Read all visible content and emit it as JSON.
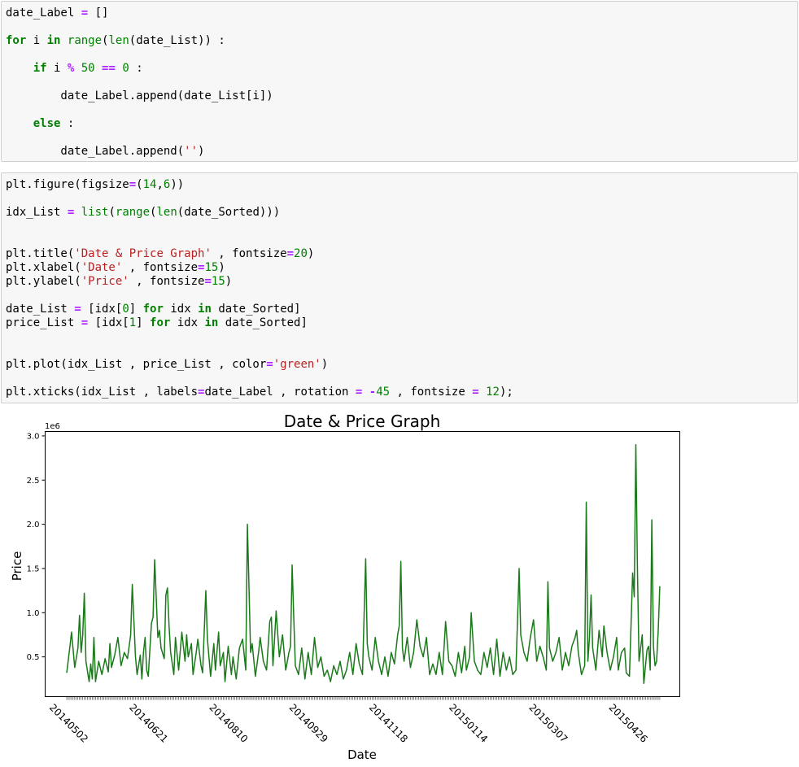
{
  "cell1": {
    "lines": [
      [
        [
          "t",
          "date_Label "
        ],
        [
          "op",
          "="
        ],
        [
          "t",
          " []"
        ]
      ],
      [
        [
          "kw",
          "for"
        ],
        [
          "t",
          " i "
        ],
        [
          "kw",
          "in"
        ],
        [
          "t",
          " "
        ],
        [
          "bi",
          "range"
        ],
        [
          "t",
          "("
        ],
        [
          "bi",
          "len"
        ],
        [
          "t",
          "(date_List)) :"
        ]
      ],
      [
        [
          "t",
          "    "
        ],
        [
          "kw",
          "if"
        ],
        [
          "t",
          " i "
        ],
        [
          "op",
          "%"
        ],
        [
          "t",
          " "
        ],
        [
          "num",
          "50"
        ],
        [
          "t",
          " "
        ],
        [
          "op",
          "=="
        ],
        [
          "t",
          " "
        ],
        [
          "num",
          "0"
        ],
        [
          "t",
          " :"
        ]
      ],
      [
        [
          "t",
          "        date_Label.append(date_List[i])"
        ]
      ],
      [
        [
          "t",
          "    "
        ],
        [
          "kw",
          "else"
        ],
        [
          "t",
          " :"
        ]
      ],
      [
        [
          "t",
          "        date_Label.append("
        ],
        [
          "str",
          "''"
        ],
        [
          "t",
          ")"
        ]
      ]
    ]
  },
  "cell2": {
    "lines": [
      [
        [
          "t",
          "plt.figure(figsize"
        ],
        [
          "op",
          "="
        ],
        [
          "t",
          "("
        ],
        [
          "num",
          "14"
        ],
        [
          "t",
          ","
        ],
        [
          "num",
          "6"
        ],
        [
          "t",
          "))"
        ]
      ],
      [
        [
          "t",
          "idx_List "
        ],
        [
          "op",
          "="
        ],
        [
          "t",
          " "
        ],
        [
          "bi",
          "list"
        ],
        [
          "t",
          "("
        ],
        [
          "bi",
          "range"
        ],
        [
          "t",
          "("
        ],
        [
          "bi",
          "len"
        ],
        [
          "t",
          "(date_Sorted)))"
        ]
      ],
      [
        [
          "t",
          "plt.title("
        ],
        [
          "str",
          "'Date & Price Graph'"
        ],
        [
          "t",
          " , fontsize"
        ],
        [
          "op",
          "="
        ],
        [
          "num",
          "20"
        ],
        [
          "t",
          ")"
        ]
      ],
      [
        [
          "t",
          "plt.xlabel("
        ],
        [
          "str",
          "'Date'"
        ],
        [
          "t",
          " , fontsize"
        ],
        [
          "op",
          "="
        ],
        [
          "num",
          "15"
        ],
        [
          "t",
          ")"
        ]
      ],
      [
        [
          "t",
          "plt.ylabel("
        ],
        [
          "str",
          "'Price'"
        ],
        [
          "t",
          " , fontsize"
        ],
        [
          "op",
          "="
        ],
        [
          "num",
          "15"
        ],
        [
          "t",
          ")"
        ]
      ],
      [
        [
          "t",
          "date_List "
        ],
        [
          "op",
          "="
        ],
        [
          "t",
          " [idx["
        ],
        [
          "num",
          "0"
        ],
        [
          "t",
          "] "
        ],
        [
          "kw",
          "for"
        ],
        [
          "t",
          " idx "
        ],
        [
          "kw",
          "in"
        ],
        [
          "t",
          " date_Sorted]"
        ]
      ],
      [
        [
          "t",
          "price_List "
        ],
        [
          "op",
          "="
        ],
        [
          "t",
          " [idx["
        ],
        [
          "num",
          "1"
        ],
        [
          "t",
          "] "
        ],
        [
          "kw",
          "for"
        ],
        [
          "t",
          " idx "
        ],
        [
          "kw",
          "in"
        ],
        [
          "t",
          " date_Sorted]"
        ]
      ],
      [
        [
          "t",
          "plt.plot(idx_List , price_List , color"
        ],
        [
          "op",
          "="
        ],
        [
          "str",
          "'green'"
        ],
        [
          "t",
          ")"
        ]
      ],
      [
        [
          "t",
          "plt.xticks(idx_List , labels"
        ],
        [
          "op",
          "="
        ],
        [
          "t",
          "date_Label , rotation "
        ],
        [
          "op",
          "="
        ],
        [
          "t",
          " "
        ],
        [
          "op",
          "-"
        ],
        [
          "num",
          "45"
        ],
        [
          "t",
          " , fontsize "
        ],
        [
          "op",
          "="
        ],
        [
          "t",
          " "
        ],
        [
          "num",
          "12"
        ],
        [
          "t",
          ");"
        ]
      ]
    ]
  },
  "chart_data": {
    "type": "line",
    "title": "Date & Price Graph",
    "xlabel": "Date",
    "ylabel": "Price",
    "offset_label": "1e6",
    "line_color": "#1a7a1a",
    "n_points": 372,
    "xlim": [
      -13.5,
      383.5
    ],
    "ylim": [
      0.05,
      3.05
    ],
    "yticks": [
      0.5,
      1.0,
      1.5,
      2.0,
      2.5,
      3.0
    ],
    "ytick_labels": [
      "0.5",
      "1.0",
      "1.5",
      "2.0",
      "2.5",
      "3.0"
    ],
    "xticks": [
      0,
      50,
      100,
      150,
      200,
      250,
      300,
      350
    ],
    "xtick_labels": [
      "20140502",
      "20140621",
      "20140810",
      "20140929",
      "20141118",
      "20150114",
      "20150307",
      "20150426"
    ],
    "y_scale": "1e6",
    "series": [
      {
        "keypoints": [
          [
            0,
            0.32
          ],
          [
            2,
            0.62
          ],
          [
            3,
            0.78
          ],
          [
            5,
            0.38
          ],
          [
            7,
            0.6
          ],
          [
            8,
            0.97
          ],
          [
            9,
            0.55
          ],
          [
            10,
            0.75
          ],
          [
            11,
            1.22
          ],
          [
            12,
            0.45
          ],
          [
            14,
            0.22
          ],
          [
            15,
            0.42
          ],
          [
            16,
            0.25
          ],
          [
            17,
            0.72
          ],
          [
            18,
            0.22
          ],
          [
            20,
            0.45
          ],
          [
            22,
            0.3
          ],
          [
            24,
            0.48
          ],
          [
            26,
            0.33
          ],
          [
            27,
            0.65
          ],
          [
            28,
            0.38
          ],
          [
            30,
            0.52
          ],
          [
            32,
            0.72
          ],
          [
            34,
            0.4
          ],
          [
            36,
            0.55
          ],
          [
            38,
            0.48
          ],
          [
            40,
            0.75
          ],
          [
            41,
            1.32
          ],
          [
            43,
            0.5
          ],
          [
            44,
            0.3
          ],
          [
            46,
            0.52
          ],
          [
            47,
            0.25
          ],
          [
            48,
            0.55
          ],
          [
            49,
            0.72
          ],
          [
            50,
            0.35
          ],
          [
            51,
            0.28
          ],
          [
            53,
            0.88
          ],
          [
            54,
            0.95
          ],
          [
            55,
            1.6
          ],
          [
            57,
            0.72
          ],
          [
            58,
            0.8
          ],
          [
            59,
            0.6
          ],
          [
            61,
            0.48
          ],
          [
            62,
            1.2
          ],
          [
            63,
            1.28
          ],
          [
            64,
            0.85
          ],
          [
            65,
            0.55
          ],
          [
            67,
            0.3
          ],
          [
            68,
            0.72
          ],
          [
            70,
            0.35
          ],
          [
            72,
            0.78
          ],
          [
            74,
            0.45
          ],
          [
            75,
            0.75
          ],
          [
            76,
            0.5
          ],
          [
            78,
            0.65
          ],
          [
            79,
            0.3
          ],
          [
            81,
            0.55
          ],
          [
            82,
            0.7
          ],
          [
            84,
            0.4
          ],
          [
            85,
            0.32
          ],
          [
            87,
            1.25
          ],
          [
            88,
            0.7
          ],
          [
            90,
            0.28
          ],
          [
            92,
            0.65
          ],
          [
            93,
            0.35
          ],
          [
            95,
            0.78
          ],
          [
            96,
            0.4
          ],
          [
            98,
            0.55
          ],
          [
            99,
            0.22
          ],
          [
            101,
            0.62
          ],
          [
            103,
            0.3
          ],
          [
            104,
            0.5
          ],
          [
            106,
            0.25
          ],
          [
            108,
            0.6
          ],
          [
            110,
            0.7
          ],
          [
            112,
            0.35
          ],
          [
            113,
            2.0
          ],
          [
            114,
            1.3
          ],
          [
            115,
            0.55
          ],
          [
            116,
            0.65
          ],
          [
            118,
            0.28
          ],
          [
            120,
            0.55
          ],
          [
            121,
            0.72
          ],
          [
            123,
            0.45
          ],
          [
            125,
            0.35
          ],
          [
            127,
            0.9
          ],
          [
            128,
            0.95
          ],
          [
            129,
            0.4
          ],
          [
            131,
            1.02
          ],
          [
            133,
            0.5
          ],
          [
            135,
            0.75
          ],
          [
            137,
            0.35
          ],
          [
            139,
            0.55
          ],
          [
            140,
            0.62
          ],
          [
            141,
            1.54
          ],
          [
            142,
            0.95
          ],
          [
            143,
            0.4
          ],
          [
            145,
            0.3
          ],
          [
            147,
            0.6
          ],
          [
            149,
            0.25
          ],
          [
            151,
            0.55
          ],
          [
            153,
            0.3
          ],
          [
            155,
            0.72
          ],
          [
            157,
            0.38
          ],
          [
            159,
            0.5
          ],
          [
            161,
            0.28
          ],
          [
            163,
            0.35
          ],
          [
            165,
            0.22
          ],
          [
            167,
            0.4
          ],
          [
            169,
            0.3
          ],
          [
            171,
            0.45
          ],
          [
            173,
            0.25
          ],
          [
            175,
            0.35
          ],
          [
            177,
            0.55
          ],
          [
            179,
            0.3
          ],
          [
            181,
            0.65
          ],
          [
            183,
            0.42
          ],
          [
            185,
            0.3
          ],
          [
            187,
            1.61
          ],
          [
            188,
            0.65
          ],
          [
            189,
            0.5
          ],
          [
            191,
            0.35
          ],
          [
            193,
            0.72
          ],
          [
            195,
            0.45
          ],
          [
            197,
            0.3
          ],
          [
            199,
            0.5
          ],
          [
            201,
            0.28
          ],
          [
            203,
            0.55
          ],
          [
            205,
            0.42
          ],
          [
            207,
            0.75
          ],
          [
            208,
            0.85
          ],
          [
            209,
            1.58
          ],
          [
            210,
            0.6
          ],
          [
            211,
            0.45
          ],
          [
            213,
            0.72
          ],
          [
            215,
            0.38
          ],
          [
            217,
            0.55
          ],
          [
            219,
            0.92
          ],
          [
            221,
            0.62
          ],
          [
            223,
            0.5
          ],
          [
            225,
            0.72
          ],
          [
            227,
            0.3
          ],
          [
            229,
            0.42
          ],
          [
            231,
            0.3
          ],
          [
            233,
            0.55
          ],
          [
            235,
            0.3
          ],
          [
            237,
            0.9
          ],
          [
            239,
            0.45
          ],
          [
            241,
            0.4
          ],
          [
            243,
            0.28
          ],
          [
            245,
            0.55
          ],
          [
            247,
            0.32
          ],
          [
            249,
            0.62
          ],
          [
            250,
            0.35
          ],
          [
            252,
            0.5
          ],
          [
            253,
            1.0
          ],
          [
            255,
            0.45
          ],
          [
            257,
            0.35
          ],
          [
            259,
            0.3
          ],
          [
            261,
            0.55
          ],
          [
            263,
            0.38
          ],
          [
            265,
            0.6
          ],
          [
            267,
            0.3
          ],
          [
            269,
            0.7
          ],
          [
            271,
            0.28
          ],
          [
            273,
            0.55
          ],
          [
            275,
            0.35
          ],
          [
            277,
            0.5
          ],
          [
            279,
            0.3
          ],
          [
            281,
            0.35
          ],
          [
            283,
            1.5
          ],
          [
            284,
            0.75
          ],
          [
            286,
            0.55
          ],
          [
            288,
            0.45
          ],
          [
            290,
            0.72
          ],
          [
            292,
            0.92
          ],
          [
            294,
            0.45
          ],
          [
            296,
            0.62
          ],
          [
            298,
            0.5
          ],
          [
            300,
            0.35
          ],
          [
            301,
            1.35
          ],
          [
            302,
            0.6
          ],
          [
            304,
            0.45
          ],
          [
            306,
            0.55
          ],
          [
            308,
            0.72
          ],
          [
            310,
            0.35
          ],
          [
            312,
            0.55
          ],
          [
            314,
            0.4
          ],
          [
            316,
            0.62
          ],
          [
            318,
            0.72
          ],
          [
            319,
            0.8
          ],
          [
            320,
            0.55
          ],
          [
            322,
            0.3
          ],
          [
            324,
            0.4
          ],
          [
            325,
            2.25
          ],
          [
            326,
            0.45
          ],
          [
            327,
            0.72
          ],
          [
            328,
            1.2
          ],
          [
            329,
            0.6
          ],
          [
            331,
            0.35
          ],
          [
            333,
            0.8
          ],
          [
            335,
            0.5
          ],
          [
            336,
            0.85
          ],
          [
            338,
            0.55
          ],
          [
            340,
            0.35
          ],
          [
            342,
            0.5
          ],
          [
            344,
            0.72
          ],
          [
            345,
            0.35
          ],
          [
            347,
            0.55
          ],
          [
            349,
            0.6
          ],
          [
            350,
            0.32
          ],
          [
            352,
            0.28
          ],
          [
            354,
            1.45
          ],
          [
            355,
            1.18
          ],
          [
            356,
            2.9
          ],
          [
            357,
            1.5
          ],
          [
            358,
            0.45
          ],
          [
            359,
            0.6
          ],
          [
            360,
            0.75
          ],
          [
            361,
            0.2
          ],
          [
            363,
            0.58
          ],
          [
            364,
            0.62
          ],
          [
            365,
            0.35
          ],
          [
            366,
            2.05
          ],
          [
            367,
            0.62
          ],
          [
            368,
            0.4
          ],
          [
            369,
            0.45
          ],
          [
            370,
            0.8
          ],
          [
            371,
            1.3
          ]
        ]
      }
    ]
  }
}
